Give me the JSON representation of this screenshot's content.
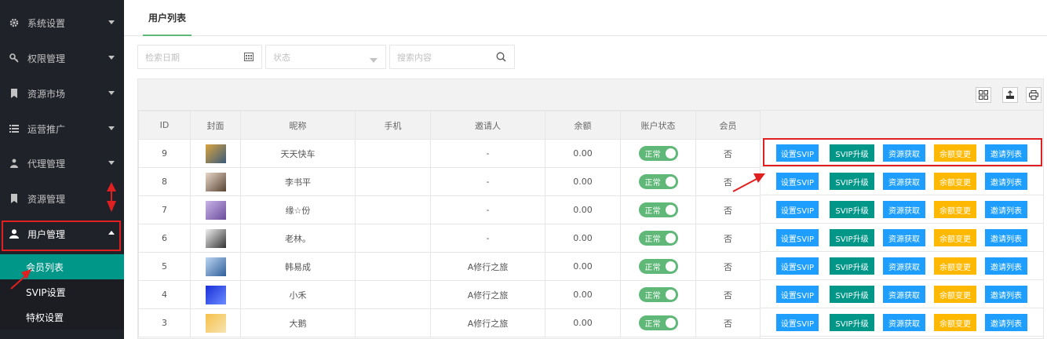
{
  "sidebar": {
    "menu": [
      {
        "label": "系统设置",
        "icon": "gear-icon"
      },
      {
        "label": "权限管理",
        "icon": "key-icon"
      },
      {
        "label": "资源市场",
        "icon": "bookmark-icon"
      },
      {
        "label": "运营推广",
        "icon": "list-icon"
      },
      {
        "label": "代理管理",
        "icon": "group-icon"
      },
      {
        "label": "资源管理",
        "icon": "bookmark-icon"
      },
      {
        "label": "用户管理",
        "icon": "user-icon"
      }
    ],
    "submenu": [
      {
        "label": "会员列表",
        "active": true
      },
      {
        "label": "SVIP设置"
      },
      {
        "label": "特权设置"
      }
    ]
  },
  "tab": {
    "label": "用户列表"
  },
  "filters": {
    "date_placeholder": "检索日期",
    "status_placeholder": "状态",
    "search_placeholder": "搜索内容"
  },
  "table": {
    "headers": [
      "ID",
      "封面",
      "昵称",
      "手机",
      "邀请人",
      "余额",
      "账户状态",
      "会员"
    ],
    "rows": [
      {
        "id": "9",
        "nickname": "天天快车",
        "phone": "",
        "inviter": "-",
        "balance": "0.00",
        "status": "正常",
        "member": "否",
        "thumb": [
          "#d9a441",
          "#3a5a7a"
        ]
      },
      {
        "id": "8",
        "nickname": "李书平",
        "phone": "",
        "inviter": "-",
        "balance": "0.00",
        "status": "正常",
        "member": "否",
        "thumb": [
          "#e8d8c8",
          "#5a4434"
        ]
      },
      {
        "id": "7",
        "nickname": "缘☆份",
        "phone": "",
        "inviter": "-",
        "balance": "0.00",
        "status": "正常",
        "member": "否",
        "thumb": [
          "#c9b4e6",
          "#6a4c9c"
        ]
      },
      {
        "id": "6",
        "nickname": "老林。",
        "phone": "",
        "inviter": "-",
        "balance": "0.00",
        "status": "正常",
        "member": "否",
        "thumb": [
          "#f0f0f0",
          "#333333"
        ]
      },
      {
        "id": "5",
        "nickname": "韩易成",
        "phone": "",
        "inviter": "A修行之旅",
        "balance": "0.00",
        "status": "正常",
        "member": "否",
        "thumb": [
          "#bcd6f2",
          "#2f5e9a"
        ]
      },
      {
        "id": "4",
        "nickname": "小禾",
        "phone": "",
        "inviter": "A修行之旅",
        "balance": "0.00",
        "status": "正常",
        "member": "否",
        "thumb": [
          "#1a2fd8",
          "#6b8cff"
        ]
      },
      {
        "id": "3",
        "nickname": "大鹅",
        "phone": "",
        "inviter": "A修行之旅",
        "balance": "0.00",
        "status": "正常",
        "member": "否",
        "thumb": [
          "#f6c04a",
          "#f6e4b0"
        ]
      }
    ]
  },
  "actions": {
    "set_svip": "设置SVIP",
    "svip_upgrade": "SVIP升级",
    "resource_get": "资源获取",
    "balance_change": "余额变更",
    "invite_list": "邀请列表"
  },
  "colors": {
    "blue": "#1e9fff",
    "teal": "#009688",
    "yellow": "#ffb800",
    "annotation_red": "#e02020"
  }
}
